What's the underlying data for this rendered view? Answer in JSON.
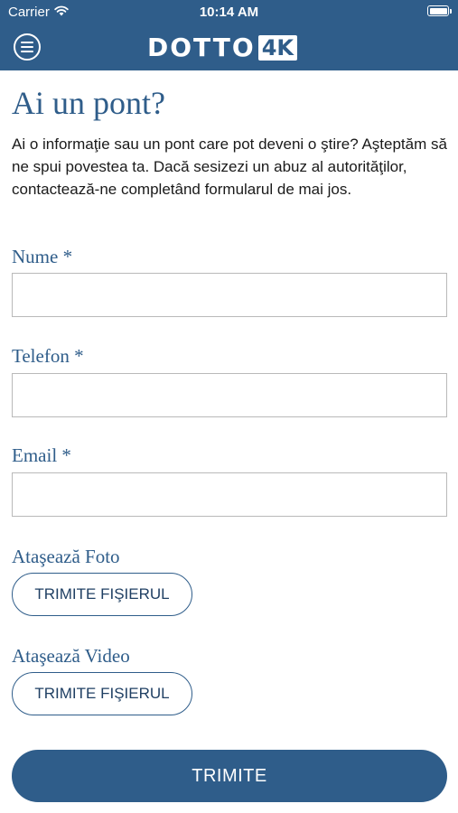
{
  "status_bar": {
    "carrier": "Carrier",
    "time": "10:14 AM",
    "battery_level": 1.0
  },
  "header": {
    "logo_text": "DOTTO",
    "logo_badge": "4K",
    "menu_icon": "hamburger-menu-icon",
    "color": "#2f5d8a"
  },
  "form": {
    "title": "Ai un pont?",
    "intro": "Ai o informaţie sau un pont care pot deveni o ştire? Aşteptăm să ne spui povestea ta. Dacă sesizezi un abuz al autorităţilor, contactează-ne completând formularul de mai jos.",
    "fields": {
      "name": {
        "label": "Nume *",
        "value": ""
      },
      "phone": {
        "label": "Telefon *",
        "value": ""
      },
      "email": {
        "label": "Email *",
        "value": ""
      }
    },
    "photo": {
      "label": "Ataşează Foto",
      "button": "TRIMITE FIŞIERUL"
    },
    "video": {
      "label": "Ataşează Video",
      "button": "TRIMITE FIŞIERUL"
    },
    "submit": "TRIMITE"
  }
}
